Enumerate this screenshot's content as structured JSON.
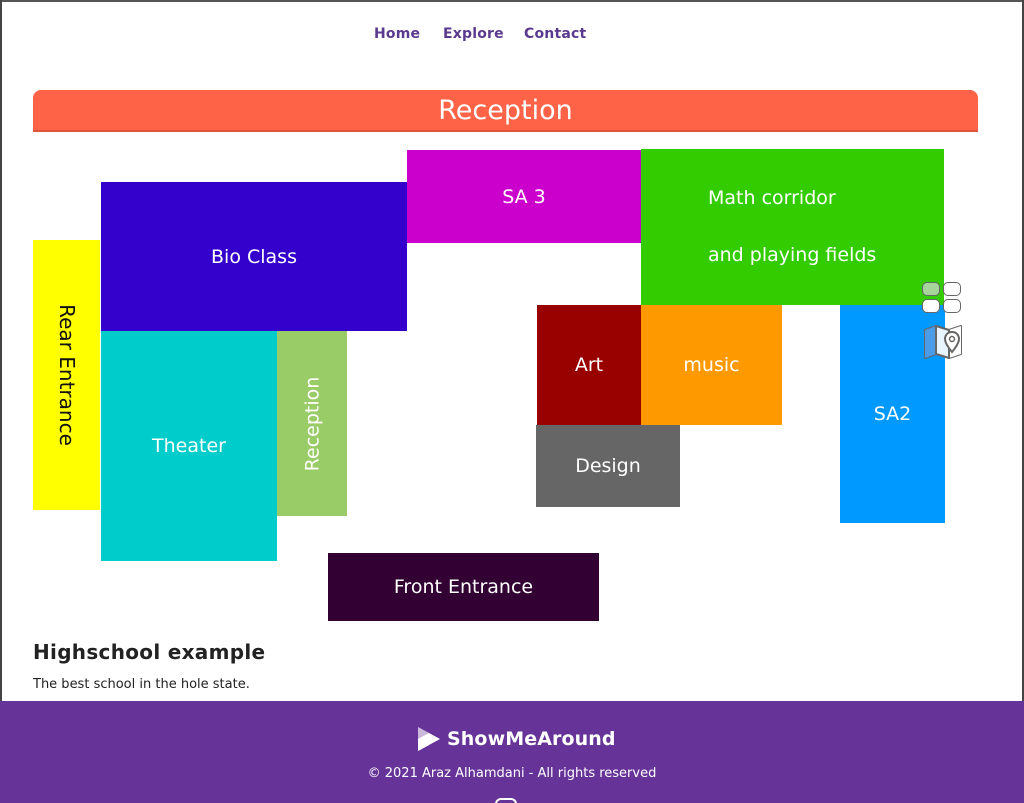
{
  "nav": {
    "items": [
      "Home",
      "Explore",
      "Contact"
    ]
  },
  "banner": {
    "title": "Reception"
  },
  "rooms": {
    "rear_entrance": "Rear Entrance",
    "bio_class": "Bio Class",
    "sa3": "SA 3",
    "math_line1": "Math corridor",
    "math_line2": "and playing fields",
    "theater": "Theater",
    "reception_side": "Reception",
    "art": "Art",
    "music": "music",
    "design": "Design",
    "sa2": "SA2",
    "front_entrance": "Front Entrance"
  },
  "room_colors": {
    "rear_entrance": "#ffff00",
    "bio_class": "#3300cc",
    "sa3": "#cc00cc",
    "math": "#33cc00",
    "theater": "#00cccc",
    "reception_side": "#99cc66",
    "art": "#990000",
    "music": "#ff9900",
    "design": "#666666",
    "sa2": "#0099ff",
    "front_entrance": "#330033",
    "banner": "#ff6347"
  },
  "side_widget": {
    "icons": [
      "grid-view-icon",
      "map-icon"
    ]
  },
  "map_info": {
    "title": "Highschool example",
    "description": "The best school in the hole state."
  },
  "footer": {
    "brand": "ShowMeAround",
    "copyright": "© 2021 Araz Alhamdani - All rights reserved",
    "background": "#663399"
  }
}
